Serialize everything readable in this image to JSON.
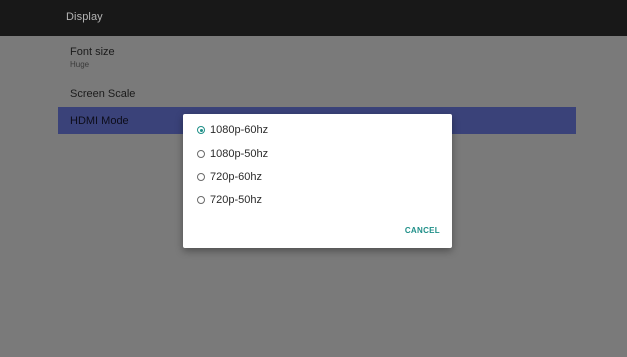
{
  "app_bar": {
    "title": "Display"
  },
  "preferences": [
    {
      "title": "Font size",
      "summary": "Huge"
    },
    {
      "title": "Screen Scale"
    },
    {
      "title": "HDMI Mode"
    }
  ],
  "dialog": {
    "options": [
      {
        "label": "1080p-60hz",
        "checked": true
      },
      {
        "label": "1080p-50hz",
        "checked": false
      },
      {
        "label": "720p-60hz",
        "checked": false
      },
      {
        "label": "720p-50hz",
        "checked": false
      }
    ],
    "cancel_label": "CANCEL"
  },
  "colors": {
    "accent": "#1f8f88",
    "selected_row": "#3a4279",
    "background": "#7a7a7a",
    "app_bar": "#181818"
  },
  "icons": {
    "radio_checked": "radio-checked-icon",
    "radio_unchecked": "radio-unchecked-icon"
  }
}
